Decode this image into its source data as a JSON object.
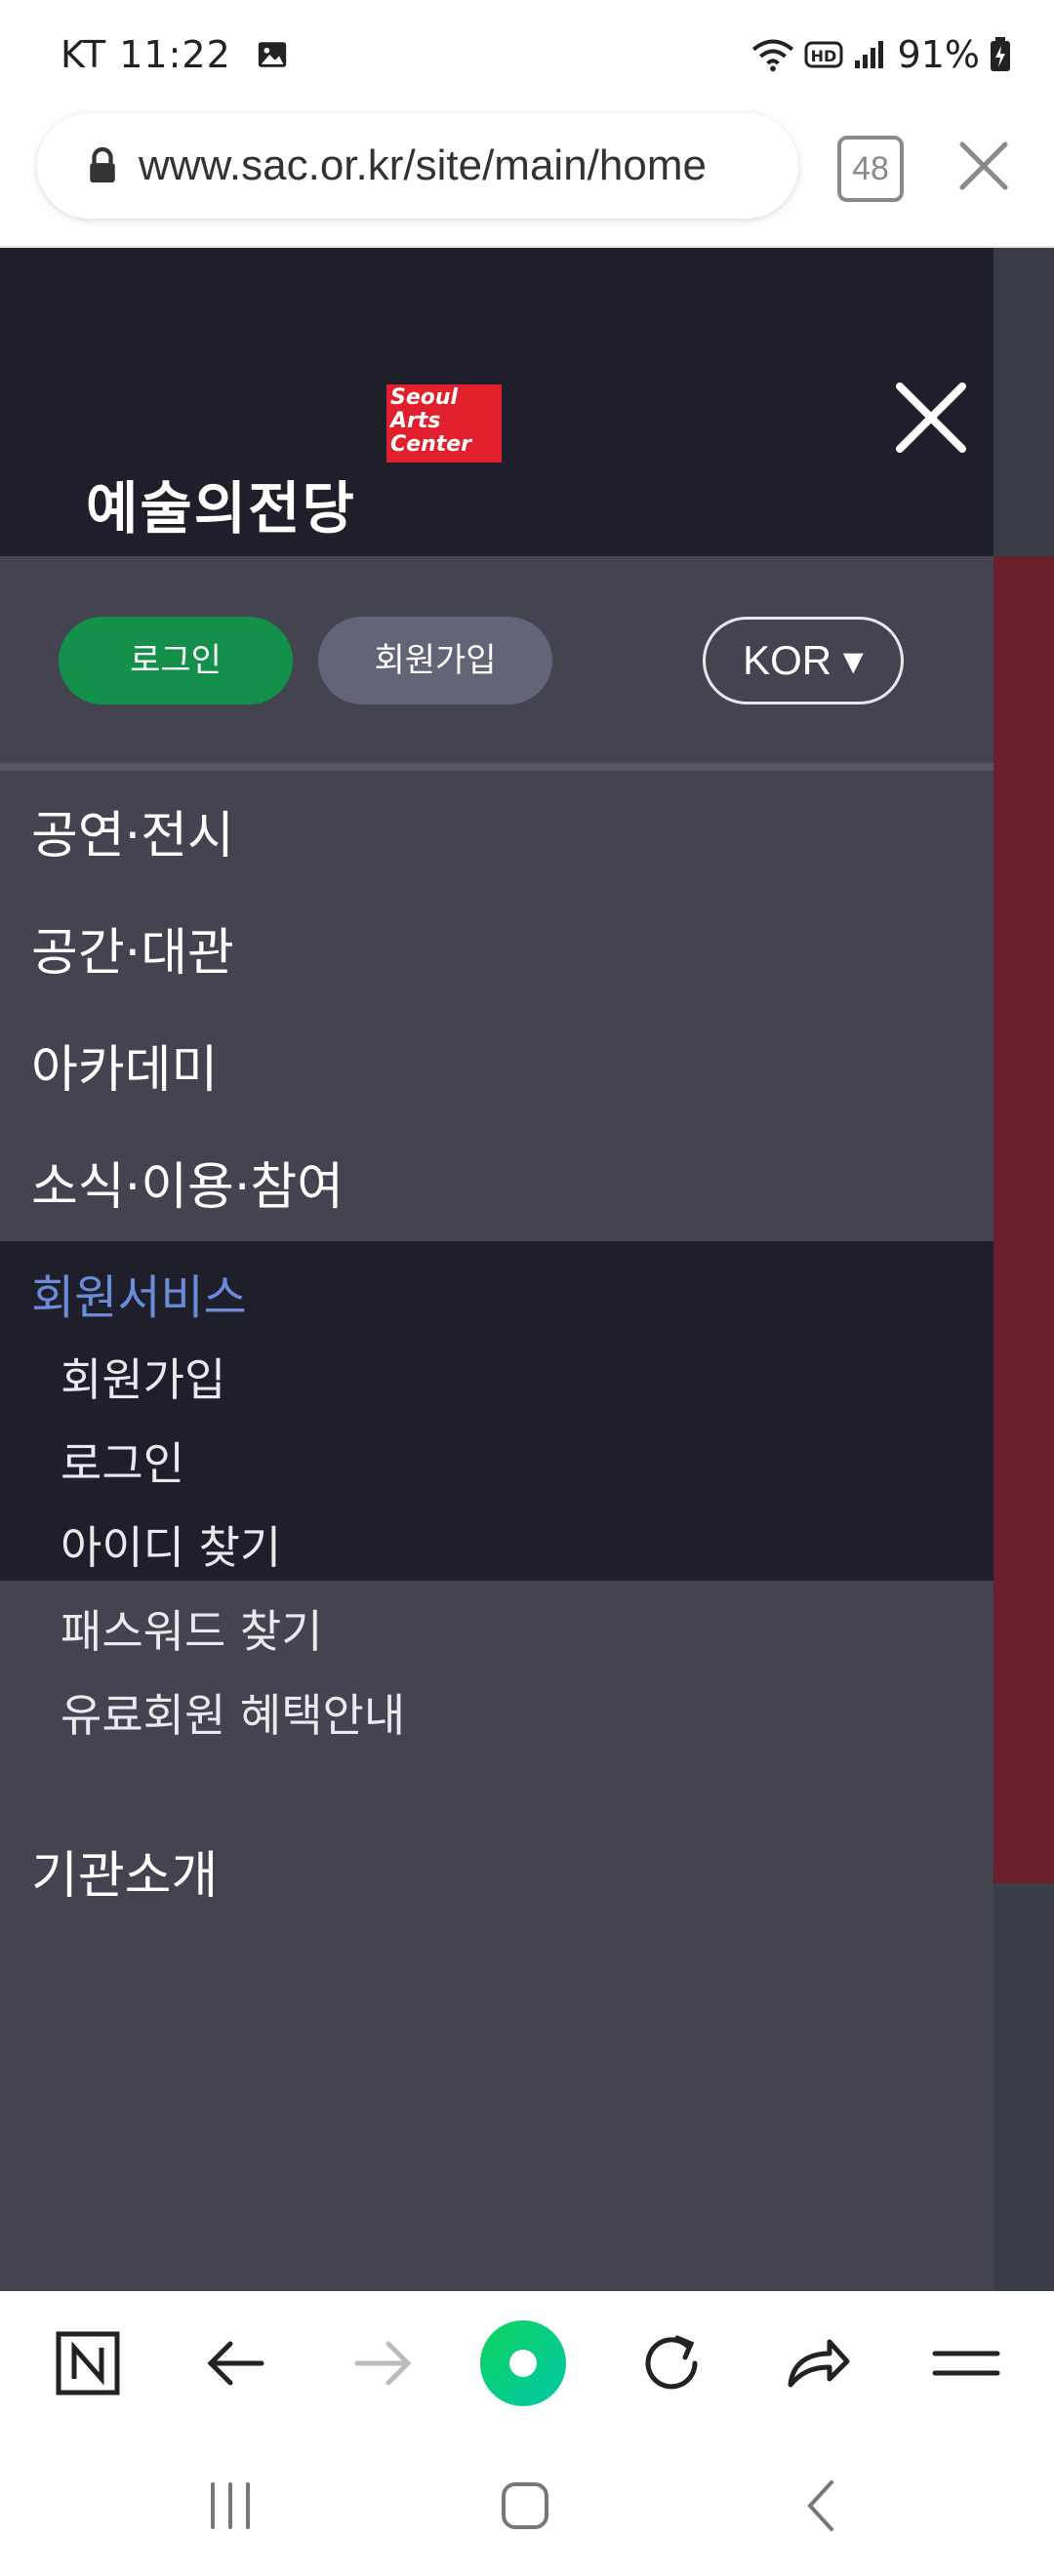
{
  "status_bar": {
    "carrier_time": "KT 11:22",
    "battery": "91%"
  },
  "browser": {
    "url": "www.sac.or.kr/site/main/home",
    "tab_count": "48"
  },
  "drawer": {
    "logo_kor": "예술의전당",
    "logo_eng": "Seoul Arts Center",
    "auth": {
      "login_label": "로그인",
      "join_label": "회원가입",
      "lang_label": "KOR ▾"
    },
    "menu": [
      {
        "label": "공연·전시"
      },
      {
        "label": "공간·대관"
      },
      {
        "label": "아카데미"
      },
      {
        "label": "소식·이용·참여"
      }
    ],
    "member_service": {
      "title": "회원서비스",
      "items": [
        {
          "label": "회원가입"
        },
        {
          "label": "로그인"
        },
        {
          "label": "아이디 찾기"
        },
        {
          "label": "패스워드 찾기"
        },
        {
          "label": "유료회원 혜택안내"
        }
      ]
    },
    "bottom_menu": [
      {
        "label": "기관소개"
      }
    ]
  },
  "colors": {
    "accent_green": "#13904a",
    "member_title_blue": "#6b8cd8",
    "logo_red": "#e2202d",
    "drawer_dark": "#1f1f2b",
    "drawer_mid": "#43444f"
  }
}
